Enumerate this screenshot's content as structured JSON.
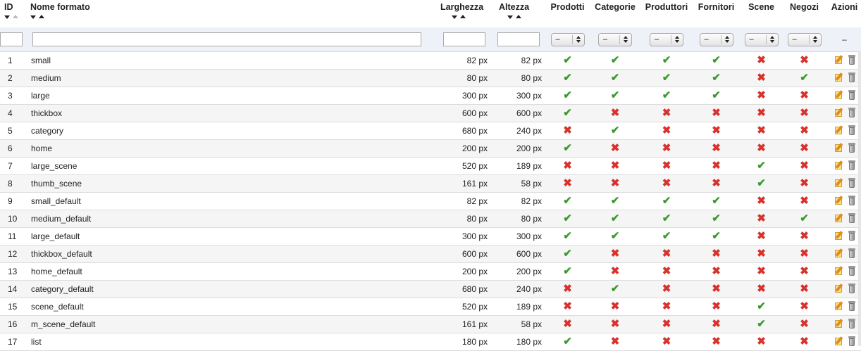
{
  "columns": {
    "id": "ID",
    "name": "Nome formato",
    "width": "Larghezza",
    "height": "Altezza",
    "products": "Prodotti",
    "categories": "Categorie",
    "manufacturers": "Produttori",
    "suppliers": "Fornitori",
    "scenes": "Scene",
    "stores": "Negozi",
    "actions": "Azioni"
  },
  "filter": {
    "select_value": "–",
    "actions_dash": "–"
  },
  "icons": {
    "yes": "check-icon",
    "no": "cross-icon",
    "edit": "edit-icon",
    "delete": "delete-icon"
  },
  "colors": {
    "yes": "#3b9a2f",
    "no": "#d9312b"
  },
  "rows": [
    {
      "id": "1",
      "name": "small",
      "width": "82 px",
      "height": "82 px",
      "flags": [
        1,
        1,
        1,
        1,
        0,
        0
      ]
    },
    {
      "id": "2",
      "name": "medium",
      "width": "80 px",
      "height": "80 px",
      "flags": [
        1,
        1,
        1,
        1,
        0,
        1
      ]
    },
    {
      "id": "3",
      "name": "large",
      "width": "300 px",
      "height": "300 px",
      "flags": [
        1,
        1,
        1,
        1,
        0,
        0
      ]
    },
    {
      "id": "4",
      "name": "thickbox",
      "width": "600 px",
      "height": "600 px",
      "flags": [
        1,
        0,
        0,
        0,
        0,
        0
      ]
    },
    {
      "id": "5",
      "name": "category",
      "width": "680 px",
      "height": "240 px",
      "flags": [
        0,
        1,
        0,
        0,
        0,
        0
      ]
    },
    {
      "id": "6",
      "name": "home",
      "width": "200 px",
      "height": "200 px",
      "flags": [
        1,
        0,
        0,
        0,
        0,
        0
      ]
    },
    {
      "id": "7",
      "name": "large_scene",
      "width": "520 px",
      "height": "189 px",
      "flags": [
        0,
        0,
        0,
        0,
        1,
        0
      ]
    },
    {
      "id": "8",
      "name": "thumb_scene",
      "width": "161 px",
      "height": "58 px",
      "flags": [
        0,
        0,
        0,
        0,
        1,
        0
      ]
    },
    {
      "id": "9",
      "name": "small_default",
      "width": "82 px",
      "height": "82 px",
      "flags": [
        1,
        1,
        1,
        1,
        0,
        0
      ]
    },
    {
      "id": "10",
      "name": "medium_default",
      "width": "80 px",
      "height": "80 px",
      "flags": [
        1,
        1,
        1,
        1,
        0,
        1
      ]
    },
    {
      "id": "11",
      "name": "large_default",
      "width": "300 px",
      "height": "300 px",
      "flags": [
        1,
        1,
        1,
        1,
        0,
        0
      ]
    },
    {
      "id": "12",
      "name": "thickbox_default",
      "width": "600 px",
      "height": "600 px",
      "flags": [
        1,
        0,
        0,
        0,
        0,
        0
      ]
    },
    {
      "id": "13",
      "name": "home_default",
      "width": "200 px",
      "height": "200 px",
      "flags": [
        1,
        0,
        0,
        0,
        0,
        0
      ]
    },
    {
      "id": "14",
      "name": "category_default",
      "width": "680 px",
      "height": "240 px",
      "flags": [
        0,
        1,
        0,
        0,
        0,
        0
      ]
    },
    {
      "id": "15",
      "name": "scene_default",
      "width": "520 px",
      "height": "189 px",
      "flags": [
        0,
        0,
        0,
        0,
        1,
        0
      ]
    },
    {
      "id": "16",
      "name": "m_scene_default",
      "width": "161 px",
      "height": "58 px",
      "flags": [
        0,
        0,
        0,
        0,
        1,
        0
      ]
    },
    {
      "id": "17",
      "name": "list",
      "width": "180 px",
      "height": "180 px",
      "flags": [
        1,
        0,
        0,
        0,
        0,
        0
      ]
    }
  ]
}
